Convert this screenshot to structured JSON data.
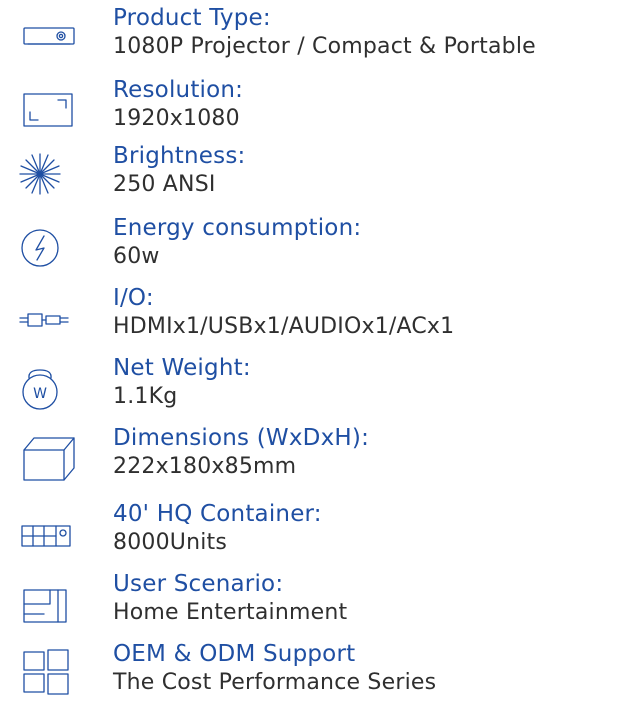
{
  "specs": [
    {
      "label": "Product Type:",
      "value": "1080P Projector / Compact & Portable",
      "icon": "projector-icon"
    },
    {
      "label": "Resolution:",
      "value": "1920x1080",
      "icon": "screen-corners-icon"
    },
    {
      "label": "Brightness:",
      "value": "250 ANSI",
      "icon": "starburst-icon"
    },
    {
      "label": "Energy consumption:",
      "value": "60w",
      "icon": "lightning-icon"
    },
    {
      "label": "I/O:",
      "value": "HDMIx1/USBx1/AUDIOx1/ACx1",
      "icon": "connector-icon"
    },
    {
      "label": "Net Weight:",
      "value": "1.1Kg",
      "icon": "weight-icon"
    },
    {
      "label": "Dimensions (WxDxH):",
      "value": "222x180x85mm",
      "icon": "box-icon"
    },
    {
      "label": "40' HQ Container:",
      "value": "8000Units",
      "icon": "container-icon"
    },
    {
      "label": "User Scenario:",
      "value": "Home Entertainment",
      "icon": "room-layout-icon"
    },
    {
      "label": "OEM & ODM Support",
      "value": "The Cost Performance Series",
      "icon": "windows-grid-icon"
    }
  ],
  "colors": {
    "label": "#1f4fa3",
    "value": "#2f2f2f",
    "icon": "#1f4fa3"
  }
}
